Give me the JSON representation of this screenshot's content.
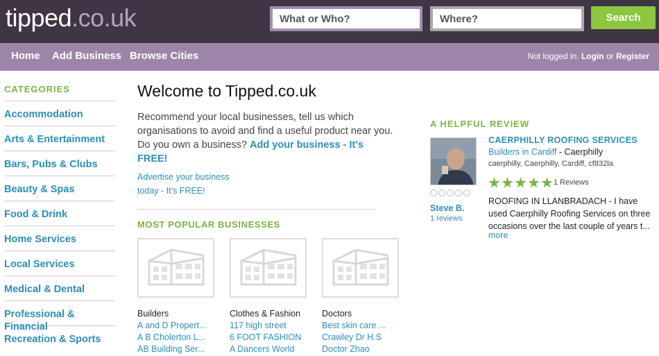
{
  "header": {
    "logo_main": "tipped",
    "logo_domain": ".co.uk",
    "search_what_placeholder": "What or Who?",
    "search_where_placeholder": "Where?",
    "search_button": "Search"
  },
  "nav": {
    "home": "Home",
    "add_business": "Add Business",
    "browse_cities": "Browse Cities",
    "status_text": "Not logged in.",
    "login": "Login",
    "or": "or",
    "register": "Register"
  },
  "sidebar": {
    "title": "CATEGORIES",
    "items": [
      "Accommodation",
      "Arts & Entertainment",
      "Bars, Pubs & Clubs",
      "Beauty & Spas",
      "Food & Drink",
      "Home Services",
      "Local Services",
      "Medical & Dental",
      "Professional & Financial",
      "Recreation & Sports"
    ]
  },
  "main": {
    "title": "Welcome to Tipped.co.uk",
    "intro_line1": "Recommend your local businesses, tell us which",
    "intro_line2": "organisations to avoid and find a useful product near you.",
    "intro_line3_prefix": "Do you own a business?",
    "intro_link": "Add your business - It's FREE!",
    "advertise_line1": "Advertise your business",
    "advertise_line2": "today - It's FREE!",
    "popular_title": "MOST POPULAR BUSINESSES",
    "popular": [
      {
        "category": "Builders",
        "links": [
          "A and D Propert...",
          "A B Cholerton L...",
          "AB Building Ser..."
        ]
      },
      {
        "category": "Clothes & Fashion",
        "links": [
          "117 high street",
          "6 FOOT FASHION",
          "A Dancers World"
        ]
      },
      {
        "category": "Doctors",
        "links": [
          "Best skin care ...",
          "Crawley Dr H.S",
          "Doctor Zhao"
        ]
      }
    ]
  },
  "review": {
    "title": "A HELPFUL REVIEW",
    "business_name": "CAERPHILLY ROOFING SERVICES",
    "category_link": "Builders in Cardiff",
    "category_suffix": " - Caerphilly",
    "address": "caerphilly, Caerphilly, Cardiff, cf832la",
    "rating": 5,
    "reviews_count": "1 Reviews",
    "reviewer_name": "Steve B.",
    "reviewer_reviews": "1 reviews",
    "text": "ROOFING IN LLANBRADACH - I have used Caerphilly Roofing Services on three occasions over the last couple of years t...",
    "more": "more"
  },
  "colors": {
    "header_bg": "#3f3544",
    "nav_bg": "#9d85a9",
    "accent_green": "#8cc63f",
    "link_blue": "#2b8fb9",
    "heading_green": "#7cb342"
  }
}
